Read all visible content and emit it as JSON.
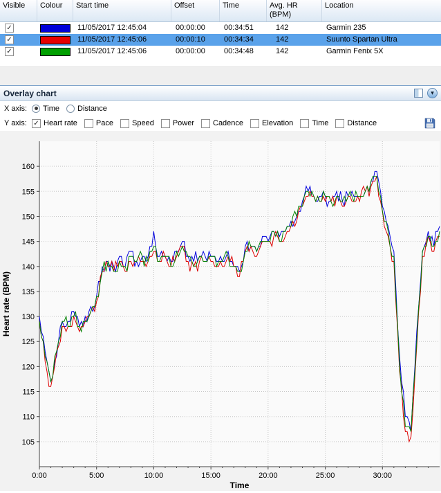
{
  "table": {
    "headers": {
      "visible": "Visible",
      "colour": "Colour",
      "start_time": "Start time",
      "offset": "Offset",
      "time": "Time",
      "avg_hr_line1": "Avg. HR",
      "avg_hr_line2": "(BPM)",
      "location": "Location"
    },
    "rows": [
      {
        "checked": "✓",
        "color": "#0000D8",
        "start_time": "11/05/2017 12:45:04",
        "offset": "00:00:00",
        "time": "00:34:51",
        "avg_hr": "142",
        "location": "Garmin 235"
      },
      {
        "checked": "✓",
        "color": "#E60000",
        "start_time": "11/05/2017 12:45:06",
        "offset": "00:00:10",
        "time": "00:34:34",
        "avg_hr": "142",
        "location": "Suunto Spartan Ultra"
      },
      {
        "checked": "✓",
        "color": "#00A000",
        "start_time": "11/05/2017 12:45:06",
        "offset": "00:00:00",
        "time": "00:34:48",
        "avg_hr": "142",
        "location": "Garmin Fenix 5X"
      }
    ]
  },
  "overlay": {
    "title": "Overlay chart",
    "collapse_icon": "▾"
  },
  "controls": {
    "x_axis_label": "X axis:",
    "x_options": [
      {
        "label": "Time",
        "selected": true
      },
      {
        "label": "Distance",
        "selected": false
      }
    ],
    "y_axis_label": "Y axis:",
    "y_options": [
      {
        "label": "Heart rate",
        "checked": "✓"
      },
      {
        "label": "Pace",
        "checked": ""
      },
      {
        "label": "Speed",
        "checked": ""
      },
      {
        "label": "Power",
        "checked": ""
      },
      {
        "label": "Cadence",
        "checked": ""
      },
      {
        "label": "Elevation",
        "checked": ""
      },
      {
        "label": "Time",
        "checked": ""
      },
      {
        "label": "Distance",
        "checked": ""
      }
    ]
  },
  "chart_data": {
    "type": "line",
    "title": "",
    "xlabel": "Time",
    "ylabel": "Heart rate (BPM)",
    "xlim": [
      0,
      35
    ],
    "ylim": [
      100,
      165
    ],
    "x_ticks": [
      "0:00",
      "5:00",
      "10:00",
      "15:00",
      "20:00",
      "25:00",
      "30:00"
    ],
    "x_tick_values": [
      0,
      5,
      10,
      15,
      20,
      25,
      30
    ],
    "y_ticks": [
      105,
      110,
      115,
      120,
      125,
      130,
      135,
      140,
      145,
      150,
      155,
      160
    ],
    "grid": true,
    "legend": "none",
    "noise": 1.4,
    "x": [
      0,
      0.5,
      1,
      1.5,
      2,
      2.5,
      3,
      3.5,
      4,
      4.5,
      5,
      5.5,
      6,
      6.5,
      7,
      7.5,
      8,
      8.5,
      9,
      9.5,
      10,
      10.5,
      11,
      11.5,
      12,
      12.5,
      13,
      13.5,
      14,
      14.5,
      15,
      15.5,
      16,
      16.5,
      17,
      17.5,
      18,
      18.5,
      19,
      19.5,
      20,
      20.5,
      21,
      21.5,
      22,
      22.5,
      23,
      23.5,
      24,
      24.5,
      25,
      25.5,
      26,
      26.5,
      27,
      27.5,
      28,
      28.5,
      29,
      29.5,
      30,
      30.5,
      31,
      31.5,
      32,
      32.5,
      33,
      33.5,
      34,
      34.5,
      35
    ],
    "series": [
      {
        "name": "Garmin 235",
        "color": "#0000DD",
        "values": [
          130,
          123,
          117,
          122,
          129,
          129,
          131,
          128,
          130,
          132,
          134,
          140,
          141,
          140,
          142,
          140,
          143,
          141,
          142,
          142,
          147,
          142,
          142,
          141,
          143,
          145,
          142,
          141,
          142,
          142,
          142,
          141,
          141,
          143,
          140,
          139,
          144,
          144,
          143,
          146,
          145,
          147,
          146,
          147,
          149,
          150,
          153,
          155,
          154,
          154,
          154,
          153,
          155,
          153,
          154,
          154,
          154,
          155,
          157,
          159,
          152,
          148,
          143,
          122,
          110,
          107,
          127,
          143,
          147,
          144,
          148
        ]
      },
      {
        "name": "Suunto Spartan Ultra",
        "color": "#DD0000",
        "values": [
          129,
          121,
          116,
          123,
          128,
          128,
          130,
          127,
          129,
          131,
          133,
          139,
          140,
          139,
          141,
          139,
          141,
          141,
          141,
          141,
          143,
          141,
          142,
          140,
          142,
          144,
          141,
          140,
          141,
          141,
          141,
          140,
          140,
          142,
          140,
          138,
          143,
          144,
          142,
          145,
          145,
          146,
          145,
          146,
          148,
          149,
          152,
          154,
          154,
          153,
          153,
          153,
          154,
          152,
          154,
          153,
          153,
          155,
          156,
          158,
          151,
          146,
          141,
          119,
          107,
          106,
          124,
          142,
          146,
          143,
          146
        ]
      },
      {
        "name": "Garmin Fenix 5X",
        "color": "#008000",
        "values": [
          129,
          122,
          117,
          123,
          129,
          128,
          130,
          128,
          129,
          131,
          134,
          139,
          141,
          139,
          141,
          140,
          142,
          141,
          142,
          141,
          144,
          141,
          142,
          140,
          143,
          144,
          142,
          140,
          142,
          141,
          142,
          140,
          141,
          142,
          140,
          139,
          143,
          144,
          143,
          145,
          145,
          147,
          145,
          147,
          148,
          150,
          152,
          155,
          154,
          153,
          154,
          153,
          154,
          153,
          154,
          153,
          154,
          155,
          157,
          158,
          151,
          147,
          142,
          120,
          108,
          107,
          125,
          143,
          146,
          144,
          147
        ]
      }
    ]
  }
}
